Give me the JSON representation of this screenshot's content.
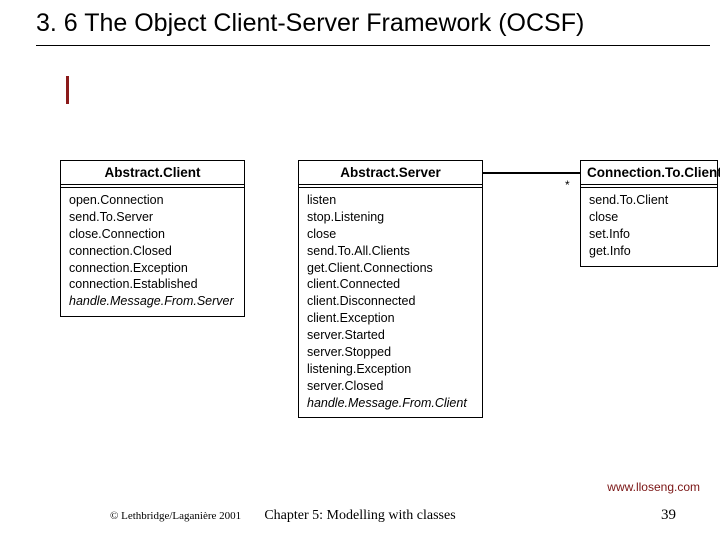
{
  "title": "3. 6 The Object Client-Server Framework (OCSF)",
  "classes": {
    "client": {
      "name": "Abstract.Client",
      "methods": [
        {
          "text": "open.Connection",
          "italic": false
        },
        {
          "text": "send.To.Server",
          "italic": false
        },
        {
          "text": "close.Connection",
          "italic": false
        },
        {
          "text": "connection.Closed",
          "italic": false
        },
        {
          "text": "connection.Exception",
          "italic": false
        },
        {
          "text": "connection.Established",
          "italic": false
        },
        {
          "text": "handle.Message.From.Server",
          "italic": true
        }
      ]
    },
    "server": {
      "name": "Abstract.Server",
      "methods": [
        {
          "text": "listen",
          "italic": false
        },
        {
          "text": "stop.Listening",
          "italic": false
        },
        {
          "text": "close",
          "italic": false
        },
        {
          "text": "send.To.All.Clients",
          "italic": false
        },
        {
          "text": "get.Client.Connections",
          "italic": false
        },
        {
          "text": "client.Connected",
          "italic": false
        },
        {
          "text": "client.Disconnected",
          "italic": false
        },
        {
          "text": "client.Exception",
          "italic": false
        },
        {
          "text": "server.Started",
          "italic": false
        },
        {
          "text": "server.Stopped",
          "italic": false
        },
        {
          "text": "listening.Exception",
          "italic": false
        },
        {
          "text": "server.Closed",
          "italic": false
        },
        {
          "text": "handle.Message.From.Client",
          "italic": true
        }
      ]
    },
    "connection": {
      "name": "Connection.To.Client",
      "methods": [
        {
          "text": "send.To.Client",
          "italic": false
        },
        {
          "text": "close",
          "italic": false
        },
        {
          "text": "set.Info",
          "italic": false
        },
        {
          "text": "get.Info",
          "italic": false
        }
      ]
    }
  },
  "association": {
    "multiplicity": "*"
  },
  "footer": {
    "url": "www.lloseng.com",
    "copyright": "© Lethbridge/Laganière 2001",
    "chapter": "Chapter 5: Modelling with classes",
    "page": "39"
  }
}
